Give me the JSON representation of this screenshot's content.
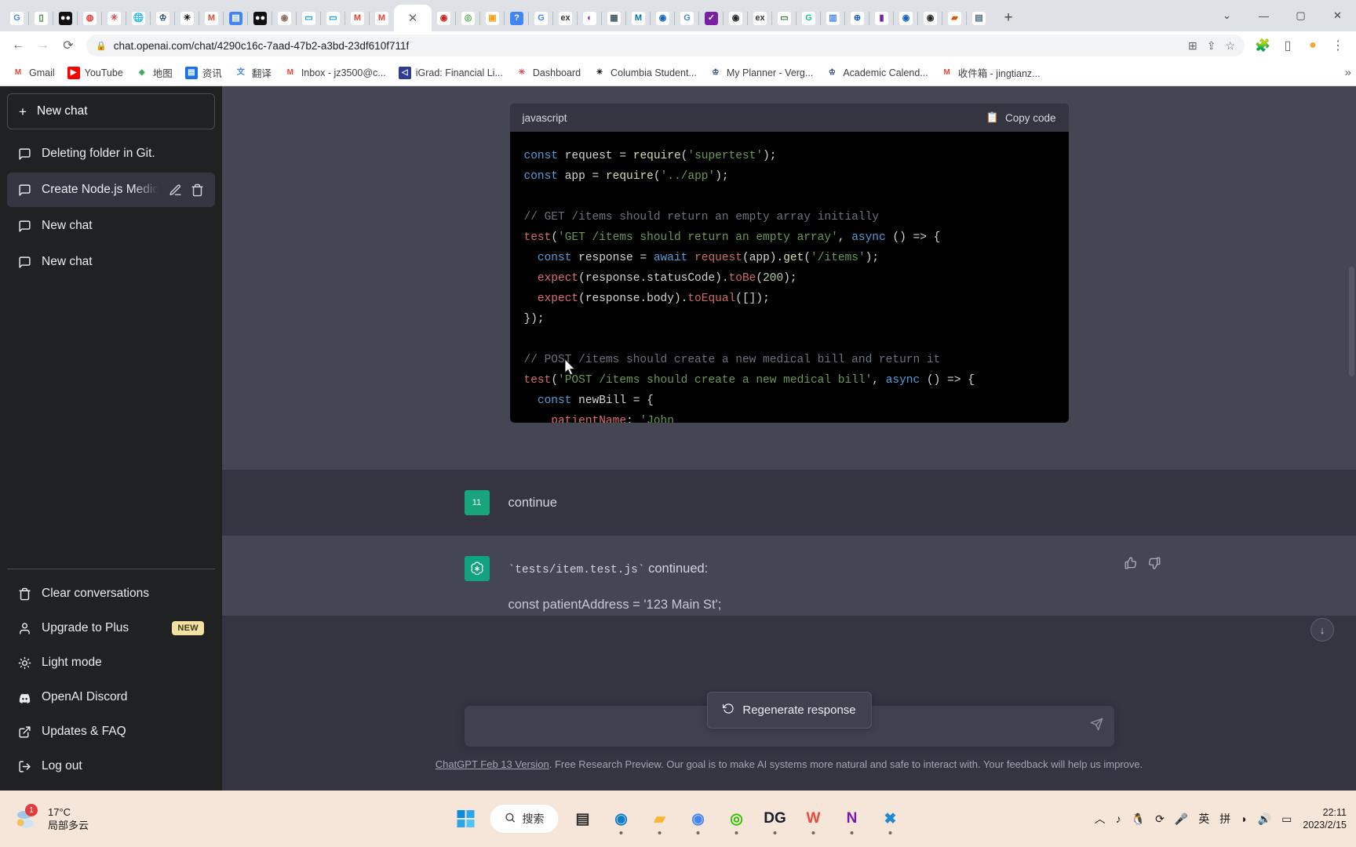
{
  "browser": {
    "tabs_mini": [
      {
        "name": "google",
        "glyph": "G",
        "bg": "#ffffff",
        "color": "#4285f4"
      },
      {
        "name": "notability",
        "glyph": "▯",
        "bg": "#ffffff",
        "color": "#2e7d32"
      },
      {
        "name": "video",
        "glyph": "●●",
        "bg": "#111111",
        "color": "#ffffff"
      },
      {
        "name": "clock",
        "glyph": "◍",
        "bg": "#ffffff",
        "color": "#e53935"
      },
      {
        "name": "canvas",
        "glyph": "✳",
        "bg": "#ffffff",
        "color": "#e2474a"
      },
      {
        "name": "globe",
        "glyph": "🌐",
        "bg": "#ffffff",
        "color": "#607d8b"
      },
      {
        "name": "columbia-crown",
        "glyph": "♔",
        "bg": "#ffffff",
        "color": "#1b3a6b"
      },
      {
        "name": "asterisk",
        "glyph": "✳",
        "bg": "#ffffff",
        "color": "#111111"
      },
      {
        "name": "gmail",
        "glyph": "M",
        "bg": "#ffffff",
        "color": "#ea4335"
      },
      {
        "name": "docs",
        "glyph": "▤",
        "bg": "#4285f4",
        "color": "#ffffff"
      },
      {
        "name": "video2",
        "glyph": "●●",
        "bg": "#111111",
        "color": "#ffffff"
      },
      {
        "name": "brain",
        "glyph": "◉",
        "bg": "#ffffff",
        "color": "#8d6e63"
      },
      {
        "name": "bilibili",
        "glyph": "▭",
        "bg": "#ffffff",
        "color": "#00a1d6"
      },
      {
        "name": "bilibili2",
        "glyph": "▭",
        "bg": "#ffffff",
        "color": "#00a1d6"
      },
      {
        "name": "gmail2",
        "glyph": "M",
        "bg": "#ffffff",
        "color": "#ea4335"
      },
      {
        "name": "gmail3",
        "glyph": "M",
        "bg": "#ffffff",
        "color": "#ea4335"
      }
    ],
    "tabs_mini_right": [
      {
        "name": "pin",
        "glyph": "◉",
        "bg": "#ffffff",
        "color": "#c62828"
      },
      {
        "name": "chrome-app",
        "glyph": "◎",
        "bg": "#ffffff",
        "color": "#4caf50"
      },
      {
        "name": "leetcode",
        "glyph": "▣",
        "bg": "#ffffff",
        "color": "#f89f1b"
      },
      {
        "name": "question",
        "glyph": "?",
        "bg": "#4285f4",
        "color": "#ffffff"
      },
      {
        "name": "google-g",
        "glyph": "G",
        "bg": "#ffffff",
        "color": "#4285f4"
      },
      {
        "name": "extension-ex",
        "glyph": "ex",
        "bg": "#ffffff",
        "color": "#333333"
      },
      {
        "name": "palette",
        "glyph": "◐",
        "bg": "#ffffff",
        "color": "#8e24aa"
      },
      {
        "name": "square",
        "glyph": "▦",
        "bg": "#ffffff",
        "color": "#455a64"
      },
      {
        "name": "mathworks",
        "glyph": "M",
        "bg": "#ffffff",
        "color": "#0076a8"
      },
      {
        "name": "spiral",
        "glyph": "◉",
        "bg": "#ffffff",
        "color": "#1565c0"
      },
      {
        "name": "google-g2",
        "glyph": "G",
        "bg": "#ffffff",
        "color": "#4285f4"
      },
      {
        "name": "check-circle",
        "glyph": "✓",
        "bg": "#7b1fa2",
        "color": "#ffffff"
      },
      {
        "name": "github",
        "glyph": "◉",
        "bg": "#ffffff",
        "color": "#24292e"
      },
      {
        "name": "extension-ex2",
        "glyph": "ex",
        "bg": "#ffffff",
        "color": "#333333"
      },
      {
        "name": "chat",
        "glyph": "▭",
        "bg": "#ffffff",
        "color": "#2e7d32"
      },
      {
        "name": "grammarly",
        "glyph": "G",
        "bg": "#ffffff",
        "color": "#15c39a"
      },
      {
        "name": "docs2",
        "glyph": "▥",
        "bg": "#ffffff",
        "color": "#4285f4"
      },
      {
        "name": "globe2",
        "glyph": "⊕",
        "bg": "#ffffff",
        "color": "#1565c0"
      },
      {
        "name": "bars",
        "glyph": "▮",
        "bg": "#ffffff",
        "color": "#7b1fa2"
      },
      {
        "name": "spiral2",
        "glyph": "◉",
        "bg": "#ffffff",
        "color": "#1565c0"
      },
      {
        "name": "github2",
        "glyph": "◉",
        "bg": "#ffffff",
        "color": "#24292e"
      },
      {
        "name": "orange-sq",
        "glyph": "▰",
        "bg": "#ffffff",
        "color": "#e65100"
      },
      {
        "name": "calendar",
        "glyph": "▤",
        "bg": "#ffffff",
        "color": "#546e7a"
      }
    ],
    "active_tab_close": "✕",
    "new_tab": "+",
    "window_controls": [
      "⌄",
      "—",
      "▢",
      "✕"
    ],
    "nav": {
      "back": "←",
      "forward": "→",
      "reload": "⟳",
      "lock": "🔒",
      "url": "chat.openai.com/chat/4290c16c-7aad-47b2-a3bd-23df610f711f"
    },
    "omnibox_right": [
      {
        "name": "translate-icon",
        "glyph": "⊞"
      },
      {
        "name": "share-icon",
        "glyph": "⇪"
      },
      {
        "name": "bookmark-star-icon",
        "glyph": "☆"
      }
    ],
    "toolbar_right": [
      {
        "name": "extensions-icon",
        "glyph": "🧩"
      },
      {
        "name": "sidepanel-icon",
        "glyph": "▯"
      },
      {
        "name": "profile-icon",
        "glyph": "●"
      },
      {
        "name": "menu-icon",
        "glyph": "⋮"
      }
    ],
    "bookmarks": [
      {
        "label": "Gmail",
        "icon": "gmail-icon",
        "glyph": "M",
        "bg": "#ffffff",
        "color": "#ea4335"
      },
      {
        "label": "YouTube",
        "icon": "youtube-icon",
        "glyph": "▶",
        "bg": "#ff0000",
        "color": "#ffffff"
      },
      {
        "label": "地图",
        "icon": "maps-icon",
        "glyph": "◈",
        "bg": "#ffffff",
        "color": "#34a853"
      },
      {
        "label": "资讯",
        "icon": "news-icon",
        "glyph": "▤",
        "bg": "#1a73e8",
        "color": "#ffffff"
      },
      {
        "label": "翻译",
        "icon": "translate-icon",
        "glyph": "文",
        "bg": "#ffffff",
        "color": "#4285f4"
      },
      {
        "label": "Inbox - jz3500@c...",
        "icon": "gmail-icon",
        "glyph": "M",
        "bg": "#ffffff",
        "color": "#ea4335"
      },
      {
        "label": "iGrad: Financial Li...",
        "icon": "igrad-icon",
        "glyph": "◁",
        "bg": "#2f3c8f",
        "color": "#ffffff"
      },
      {
        "label": "Dashboard",
        "icon": "canvas-icon",
        "glyph": "✳",
        "bg": "#ffffff",
        "color": "#e2474a"
      },
      {
        "label": "Columbia Student...",
        "icon": "asterisk-icon",
        "glyph": "✳",
        "bg": "#ffffff",
        "color": "#111111"
      },
      {
        "label": "My Planner - Verg...",
        "icon": "crown-icon",
        "glyph": "♔",
        "bg": "#ffffff",
        "color": "#1b3a6b"
      },
      {
        "label": "Academic Calend...",
        "icon": "crown-icon",
        "glyph": "♔",
        "bg": "#ffffff",
        "color": "#1b3a6b"
      },
      {
        "label": "收件箱 - jingtianz...",
        "icon": "gmail-icon",
        "glyph": "M",
        "bg": "#ffffff",
        "color": "#ea4335"
      }
    ],
    "bookmarks_overflow": "»"
  },
  "sidebar": {
    "new_chat": "New chat",
    "conversations": [
      {
        "title": "Deleting folder in Git.",
        "active": false
      },
      {
        "title": "Create Node.js Medical Billing API",
        "active": true
      },
      {
        "title": "New chat",
        "active": false
      },
      {
        "title": "New chat",
        "active": false
      }
    ],
    "bottom_items": [
      {
        "label": "Clear conversations",
        "icon": "trash-icon",
        "badge": ""
      },
      {
        "label": "Upgrade to Plus",
        "icon": "user-icon",
        "badge": "NEW"
      },
      {
        "label": "Light mode",
        "icon": "sun-icon",
        "badge": ""
      },
      {
        "label": "OpenAI Discord",
        "icon": "discord-icon",
        "badge": ""
      },
      {
        "label": "Updates & FAQ",
        "icon": "external-link-icon",
        "badge": ""
      },
      {
        "label": "Log out",
        "icon": "logout-icon",
        "badge": ""
      }
    ]
  },
  "code_block": {
    "language": "javascript",
    "copy_label": "Copy code",
    "lines": [
      [
        {
          "t": "const ",
          "c": "c-kw"
        },
        {
          "t": "request",
          "c": "c-plain"
        },
        {
          "t": " = ",
          "c": "c-plain"
        },
        {
          "t": "require",
          "c": "c-fn"
        },
        {
          "t": "(",
          "c": "c-plain"
        },
        {
          "t": "'supertest'",
          "c": "c-str"
        },
        {
          "t": ");",
          "c": "c-plain"
        }
      ],
      [
        {
          "t": "const ",
          "c": "c-kw"
        },
        {
          "t": "app",
          "c": "c-plain"
        },
        {
          "t": " = ",
          "c": "c-plain"
        },
        {
          "t": "require",
          "c": "c-fn"
        },
        {
          "t": "(",
          "c": "c-plain"
        },
        {
          "t": "'../app'",
          "c": "c-str"
        },
        {
          "t": ");",
          "c": "c-plain"
        }
      ],
      [],
      [
        {
          "t": "// GET /items should return an empty array initially",
          "c": "c-cmt"
        }
      ],
      [
        {
          "t": "test",
          "c": "c-pnk"
        },
        {
          "t": "(",
          "c": "c-plain"
        },
        {
          "t": "'GET /items should return an empty array'",
          "c": "c-str"
        },
        {
          "t": ", ",
          "c": "c-plain"
        },
        {
          "t": "async",
          "c": "c-kw"
        },
        {
          "t": " () => {",
          "c": "c-plain"
        }
      ],
      [
        {
          "t": "  const ",
          "c": "c-kw"
        },
        {
          "t": "response",
          "c": "c-plain"
        },
        {
          "t": " = ",
          "c": "c-plain"
        },
        {
          "t": "await ",
          "c": "c-kw"
        },
        {
          "t": "request",
          "c": "c-pnk"
        },
        {
          "t": "(app).",
          "c": "c-plain"
        },
        {
          "t": "get",
          "c": "c-fn"
        },
        {
          "t": "(",
          "c": "c-plain"
        },
        {
          "t": "'/items'",
          "c": "c-str"
        },
        {
          "t": ");",
          "c": "c-plain"
        }
      ],
      [
        {
          "t": "  expect",
          "c": "c-red"
        },
        {
          "t": "(response.statusCode).",
          "c": "c-plain"
        },
        {
          "t": "toBe",
          "c": "c-pnk"
        },
        {
          "t": "(",
          "c": "c-plain"
        },
        {
          "t": "200",
          "c": "c-num"
        },
        {
          "t": ");",
          "c": "c-plain"
        }
      ],
      [
        {
          "t": "  expect",
          "c": "c-red"
        },
        {
          "t": "(response.body).",
          "c": "c-plain"
        },
        {
          "t": "toEqual",
          "c": "c-pnk"
        },
        {
          "t": "([]);",
          "c": "c-plain"
        }
      ],
      [
        {
          "t": "});",
          "c": "c-plain"
        }
      ],
      [],
      [
        {
          "t": "// POST /items should create a new medical bill and return it",
          "c": "c-cmt"
        }
      ],
      [
        {
          "t": "test",
          "c": "c-pnk"
        },
        {
          "t": "(",
          "c": "c-plain"
        },
        {
          "t": "'POST /items should create a new medical bill'",
          "c": "c-str"
        },
        {
          "t": ", ",
          "c": "c-plain"
        },
        {
          "t": "async",
          "c": "c-kw"
        },
        {
          "t": " () => {",
          "c": "c-plain"
        }
      ],
      [
        {
          "t": "  const ",
          "c": "c-kw"
        },
        {
          "t": "newBill",
          "c": "c-plain"
        },
        {
          "t": " = {",
          "c": "c-plain"
        }
      ],
      [
        {
          "t": "    patientName",
          "c": "c-red"
        },
        {
          "t": ": ",
          "c": "c-plain"
        },
        {
          "t": "'John",
          "c": "c-str"
        }
      ]
    ]
  },
  "messages": {
    "user": {
      "avatar_label": "11",
      "text": "continue"
    },
    "assistant": {
      "avatar_label": "",
      "text_code": "`tests/item.test.js`",
      "text_after": " continued:",
      "partial_line": "const patientAddress = '123 Main St';",
      "thumbs_up": "👍",
      "thumbs_down": "👎"
    }
  },
  "regenerate": {
    "label": "Regenerate response",
    "icon": "refresh-icon"
  },
  "composer": {
    "placeholder": "",
    "value": "",
    "send_icon": "send-icon"
  },
  "footer": {
    "link": "ChatGPT Feb 13 Version",
    "text": ". Free Research Preview. Our goal is to make AI systems more natural and safe to interact with. Your feedback will help us improve."
  },
  "scroll_down_icon": "↓",
  "taskbar": {
    "weather": {
      "temp": "17°C",
      "condition": "局部多云",
      "badge": "1"
    },
    "start": "start-icon",
    "search_label": "搜索",
    "apps": [
      {
        "name": "taskview-icon",
        "glyph": "▤",
        "color": "#2b2b2b",
        "running": false
      },
      {
        "name": "edge-icon",
        "glyph": "◉",
        "color": "#0f7ec8",
        "running": true
      },
      {
        "name": "explorer-icon",
        "glyph": "▰",
        "color": "#f7b733",
        "running": true
      },
      {
        "name": "chrome-icon",
        "glyph": "◉",
        "color": "#4285f4",
        "running": true
      },
      {
        "name": "wechat-icon",
        "glyph": "◎",
        "color": "#2dc100",
        "running": true
      },
      {
        "name": "dg-icon",
        "glyph": "DG",
        "color": "#1a1a2e",
        "running": true
      },
      {
        "name": "wps-icon",
        "glyph": "W",
        "color": "#e74c3c",
        "running": true
      },
      {
        "name": "onenote-icon",
        "glyph": "N",
        "color": "#7719aa",
        "running": true
      },
      {
        "name": "vscode-icon",
        "glyph": "✖",
        "color": "#1f8ad2",
        "running": true
      }
    ],
    "tray": [
      {
        "name": "chevron-up-icon",
        "glyph": "︿"
      },
      {
        "name": "netease-music-icon",
        "glyph": "♪"
      },
      {
        "name": "qq-icon",
        "glyph": "🐧"
      },
      {
        "name": "sync-icon",
        "glyph": "⟳"
      },
      {
        "name": "microphone-icon",
        "glyph": "🎤"
      },
      {
        "name": "ime-english-icon",
        "glyph": "英"
      },
      {
        "name": "ime-pinyin-icon",
        "glyph": "拼"
      },
      {
        "name": "wifi-icon",
        "glyph": "◗"
      },
      {
        "name": "volume-icon",
        "glyph": "🔊"
      },
      {
        "name": "battery-icon",
        "glyph": "▭"
      }
    ],
    "clock": {
      "time": "22:11",
      "date": "2023/2/15"
    }
  }
}
